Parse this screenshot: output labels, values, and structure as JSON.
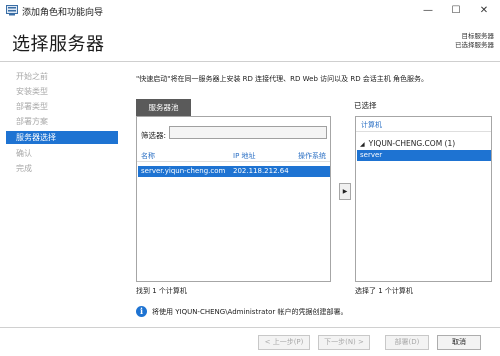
{
  "window": {
    "title": "添加角色和功能向导",
    "minimize_glyph": "—",
    "maximize_glyph": "☐",
    "close_glyph": "✕"
  },
  "header": {
    "page_title": "选择服务器",
    "destination_label": "目标服务器",
    "destination_value": "已选择服务器"
  },
  "nav": {
    "items": [
      {
        "label": "开始之前",
        "active": false
      },
      {
        "label": "安装类型",
        "active": false
      },
      {
        "label": "部署类型",
        "active": false
      },
      {
        "label": "部署方案",
        "active": false
      },
      {
        "label": "服务器选择",
        "active": true
      },
      {
        "label": "确认",
        "active": false
      },
      {
        "label": "完成",
        "active": false
      }
    ]
  },
  "content": {
    "intro": "\"快速启动\"将在同一服务器上安装 RD 连接代理、RD Web 访问以及 RD 会话主机 角色服务。",
    "pool": {
      "tab_label": "服务器池",
      "filter_label": "筛选器:",
      "filter_value": "",
      "columns": [
        "名称",
        "IP 地址",
        "操作系统"
      ],
      "rows": [
        {
          "name": "server.yiqun-cheng.com",
          "ip": "202.118.212.64",
          "os": ""
        }
      ],
      "count_text": "找到 1 个计算机"
    },
    "add_arrow": "▶",
    "selected": {
      "label": "已选择",
      "column": "计算机",
      "group_toggle": "◢",
      "group_name": "YIQUN-CHENG.COM (1)",
      "server": "server",
      "count_text": "选择了 1 个计算机"
    },
    "info": {
      "icon": "i",
      "text": "将使用 YIQUN-CHENG\\Administrator 帐户的凭据创建部署。"
    }
  },
  "footer": {
    "back": "< 上一步(P)",
    "next": "下一步(N) >",
    "deploy": "部署(D)",
    "cancel": "取消"
  },
  "colors": {
    "accent": "#1e73d2",
    "tab": "#5a5a5a",
    "disabled_text": "#a8a8a8"
  }
}
